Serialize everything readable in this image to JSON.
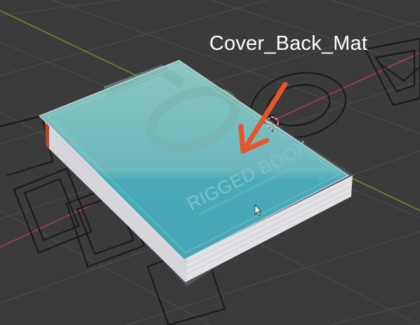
{
  "viewport": {
    "annotation_label": "Cover_Back_Mat",
    "book_title": "RIGGED BOOK",
    "book_subtitle": "A BLENDER ADDON USED TO GENERATE RIGGED BOOKS",
    "spine_text": "BY",
    "colors": {
      "background": "#3b3b3b",
      "grid": "#4a4a4a",
      "x_axis": "#a6404a",
      "y_axis": "#6a8a2a",
      "cover_top": "#88c4bb",
      "cover_bottom": "#4aaab8",
      "selection_outline": "#e8e8e8",
      "arrow": "#e8552b",
      "pages": "#dcdce0"
    },
    "icons": [
      "mouse-cursor-icon",
      "3d-cursor-icon",
      "annotation-arrow-icon"
    ]
  }
}
